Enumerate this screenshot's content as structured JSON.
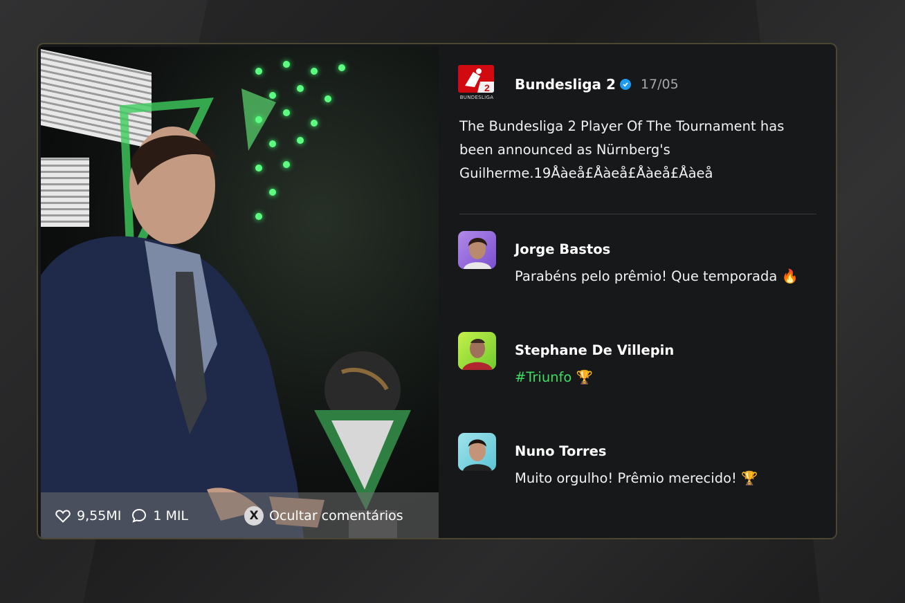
{
  "post": {
    "author": "Bundesliga 2",
    "date": "17/05",
    "logo_caption": "BUNDESLIGA",
    "text": "The Bundesliga 2 Player Of The Tournament has been announced as Nürnberg's Guilherme.19Åàeå£Åàeå£Åàeå£Åàeå",
    "likes": "9,55MI",
    "comments_count": "1 MIL",
    "hide_button_key": "X",
    "hide_comments_label": "Ocultar comentários"
  },
  "comments": [
    {
      "name": "Jorge Bastos",
      "text": "Parabéns pelo prêmio! Que temporada 🔥",
      "hashtag": ""
    },
    {
      "name": "Stephane De Villepin",
      "text": "🏆",
      "hashtag": "#Triunfo"
    },
    {
      "name": "Nuno Torres",
      "text": "Muito orgulho! Prêmio merecido! 🏆",
      "hashtag": ""
    }
  ],
  "colors": {
    "accent_green": "#3ddc63",
    "verified_blue": "#1d9bf0",
    "border_gold": "#4d4630"
  },
  "icons": [
    "heart-icon",
    "comment-bubble-icon",
    "x-button-icon",
    "verified-badge-icon",
    "bundesliga-2-logo"
  ]
}
